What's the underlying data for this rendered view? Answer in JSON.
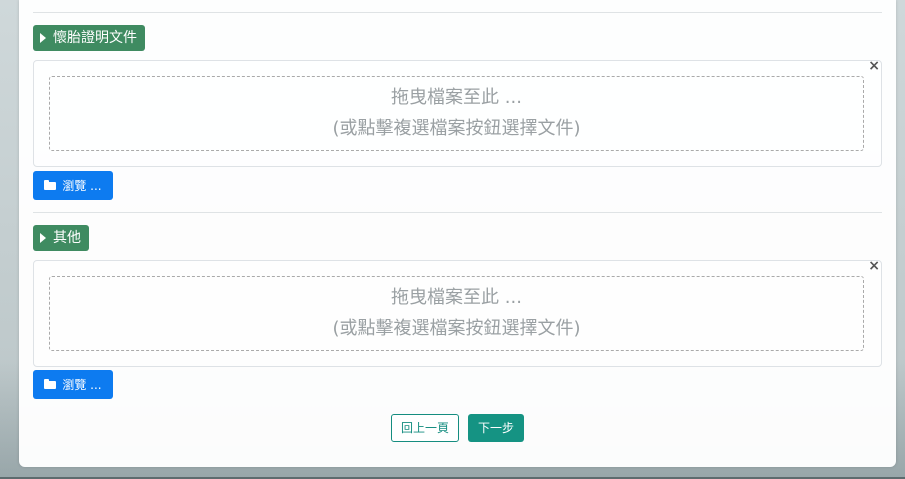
{
  "sections": [
    {
      "label": "懷胎證明文件",
      "dropzone_line1": "拖曳檔案至此 ...",
      "dropzone_line2": "(或點擊複選檔案按鈕選擇文件)",
      "close": "×",
      "browse_label": "瀏覽 ..."
    },
    {
      "label": "其他",
      "dropzone_line1": "拖曳檔案至此 ...",
      "dropzone_line2": "(或點擊複選檔案按鈕選擇文件)",
      "close": "×",
      "browse_label": "瀏覽 ..."
    }
  ],
  "nav": {
    "prev_label": "回上一頁",
    "next_label": "下一步"
  },
  "colors": {
    "badge": "#3f8b61",
    "browse": "#0d7bf0",
    "teal": "#159383"
  },
  "icons": [
    "play-icon",
    "folder-icon",
    "close-icon"
  ]
}
